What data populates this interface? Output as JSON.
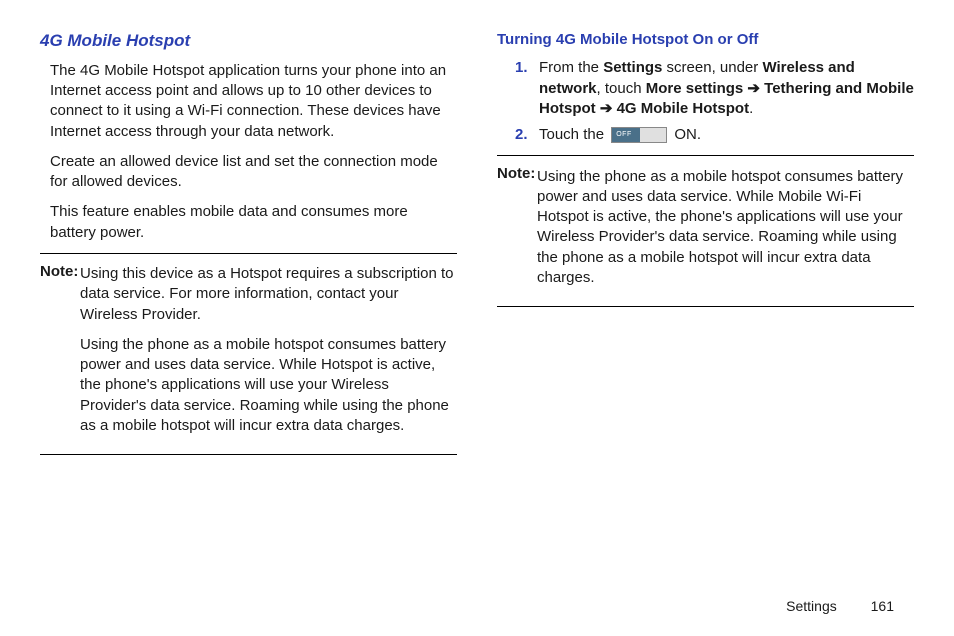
{
  "left": {
    "heading": "4G Mobile Hotspot",
    "p1": "The 4G Mobile Hotspot application turns your phone into an Internet access point and allows up to 10 other devices to connect to it using a Wi-Fi connection. These devices have Internet access through your data network.",
    "p2": "Create an allowed device list and set the connection mode for allowed devices.",
    "p3": "This feature enables mobile data and consumes more battery power.",
    "note": {
      "label": "Note:",
      "l1": "Using this device as a Hotspot requires a subscription to data service. For more information, contact your Wireless Provider.",
      "l2": "Using the phone as a mobile hotspot consumes battery power and uses data service. While Hotspot is active, the phone's applications will use your Wireless Provider's data service. Roaming while using the phone as a mobile hotspot will incur extra data charges."
    }
  },
  "right": {
    "heading": "Turning 4G Mobile Hotspot On or Off",
    "step1": {
      "num": "1.",
      "pre": "From the ",
      "b1": "Settings",
      "mid1": " screen, under ",
      "b2": "Wireless and network",
      "mid2": ", touch ",
      "b3": "More settings",
      "arr1": " ➔ ",
      "b4": "Tethering and Mobile Hotspot",
      "arr2": " ➔ ",
      "b5": "4G Mobile Hotspot",
      "end": "."
    },
    "step2": {
      "num": "2.",
      "pre": "Touch the ",
      "toggle": "OFF",
      "post": " ON."
    },
    "note": {
      "label": "Note:",
      "l1": "Using the phone as a mobile hotspot consumes battery power and uses data service. While Mobile Wi-Fi Hotspot is active, the phone's applications will use your Wireless Provider's data service. Roaming while using the phone as a mobile hotspot will incur extra data charges."
    }
  },
  "footer": {
    "section": "Settings",
    "page": "161"
  }
}
